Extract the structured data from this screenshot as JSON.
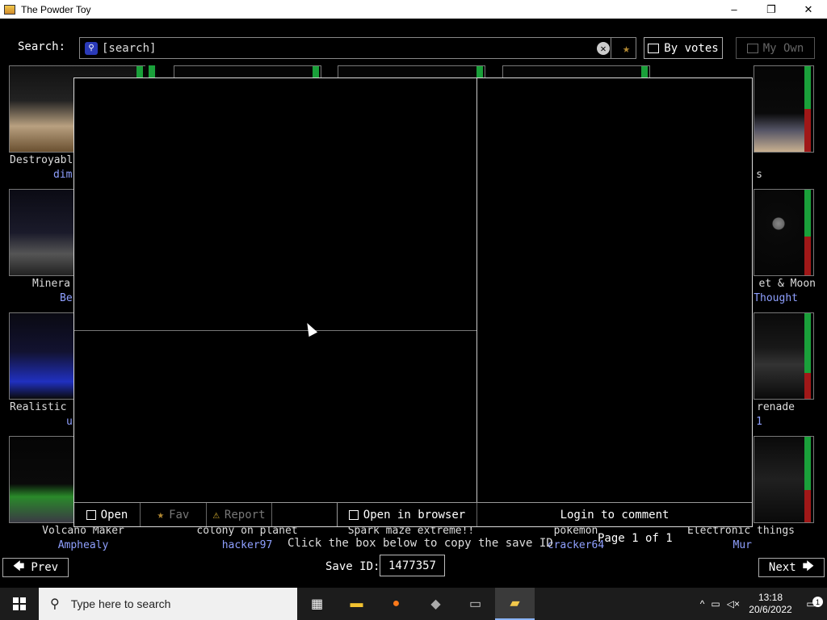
{
  "window": {
    "title": "The Powder Toy",
    "minimize": "–",
    "restore": "❐",
    "close": "✕"
  },
  "toolbar": {
    "search_label": "Search:",
    "search_value": "[search]",
    "sort_label": "By votes",
    "myown_label": "My Own"
  },
  "saves": [
    {
      "title": "Destroyabl",
      "author": "dim"
    },
    {
      "title": "Minera",
      "author": "Be"
    },
    {
      "title": "Realistic",
      "author": "u"
    },
    {
      "title": "Volcano Maker",
      "author": "Amphealy"
    },
    {
      "title": "colony on planet",
      "author": "hacker97"
    },
    {
      "title": "Spark maze extreme!!",
      "author": ""
    },
    {
      "title": "pokemon",
      "author": "cracker64"
    },
    {
      "title": "Electronic things",
      "author": "Mur"
    },
    {
      "title": "s",
      "author": ""
    },
    {
      "title": "et & Moon",
      "author": "Thought"
    },
    {
      "title": "renade",
      "author": "1"
    }
  ],
  "pagination": {
    "page_info": "Page 1 of 1",
    "prev_label": "Prev",
    "next_label": "Next",
    "hint": "Click the box below to copy the save ID",
    "save_id_label": "Save ID:",
    "save_id": "1477357"
  },
  "dialog": {
    "open_label": "Open",
    "fav_label": "Fav",
    "report_label": "Report",
    "browser_label": "Open in browser",
    "login_label": "Login to comment"
  },
  "taskbar": {
    "search_placeholder": "Type here to search",
    "time": "13:18",
    "date": "20/6/2022",
    "notification_count": "1"
  },
  "colors": {
    "upvote": "#1aa03a",
    "downvote": "#a01818",
    "author": "#8fa0ff"
  }
}
